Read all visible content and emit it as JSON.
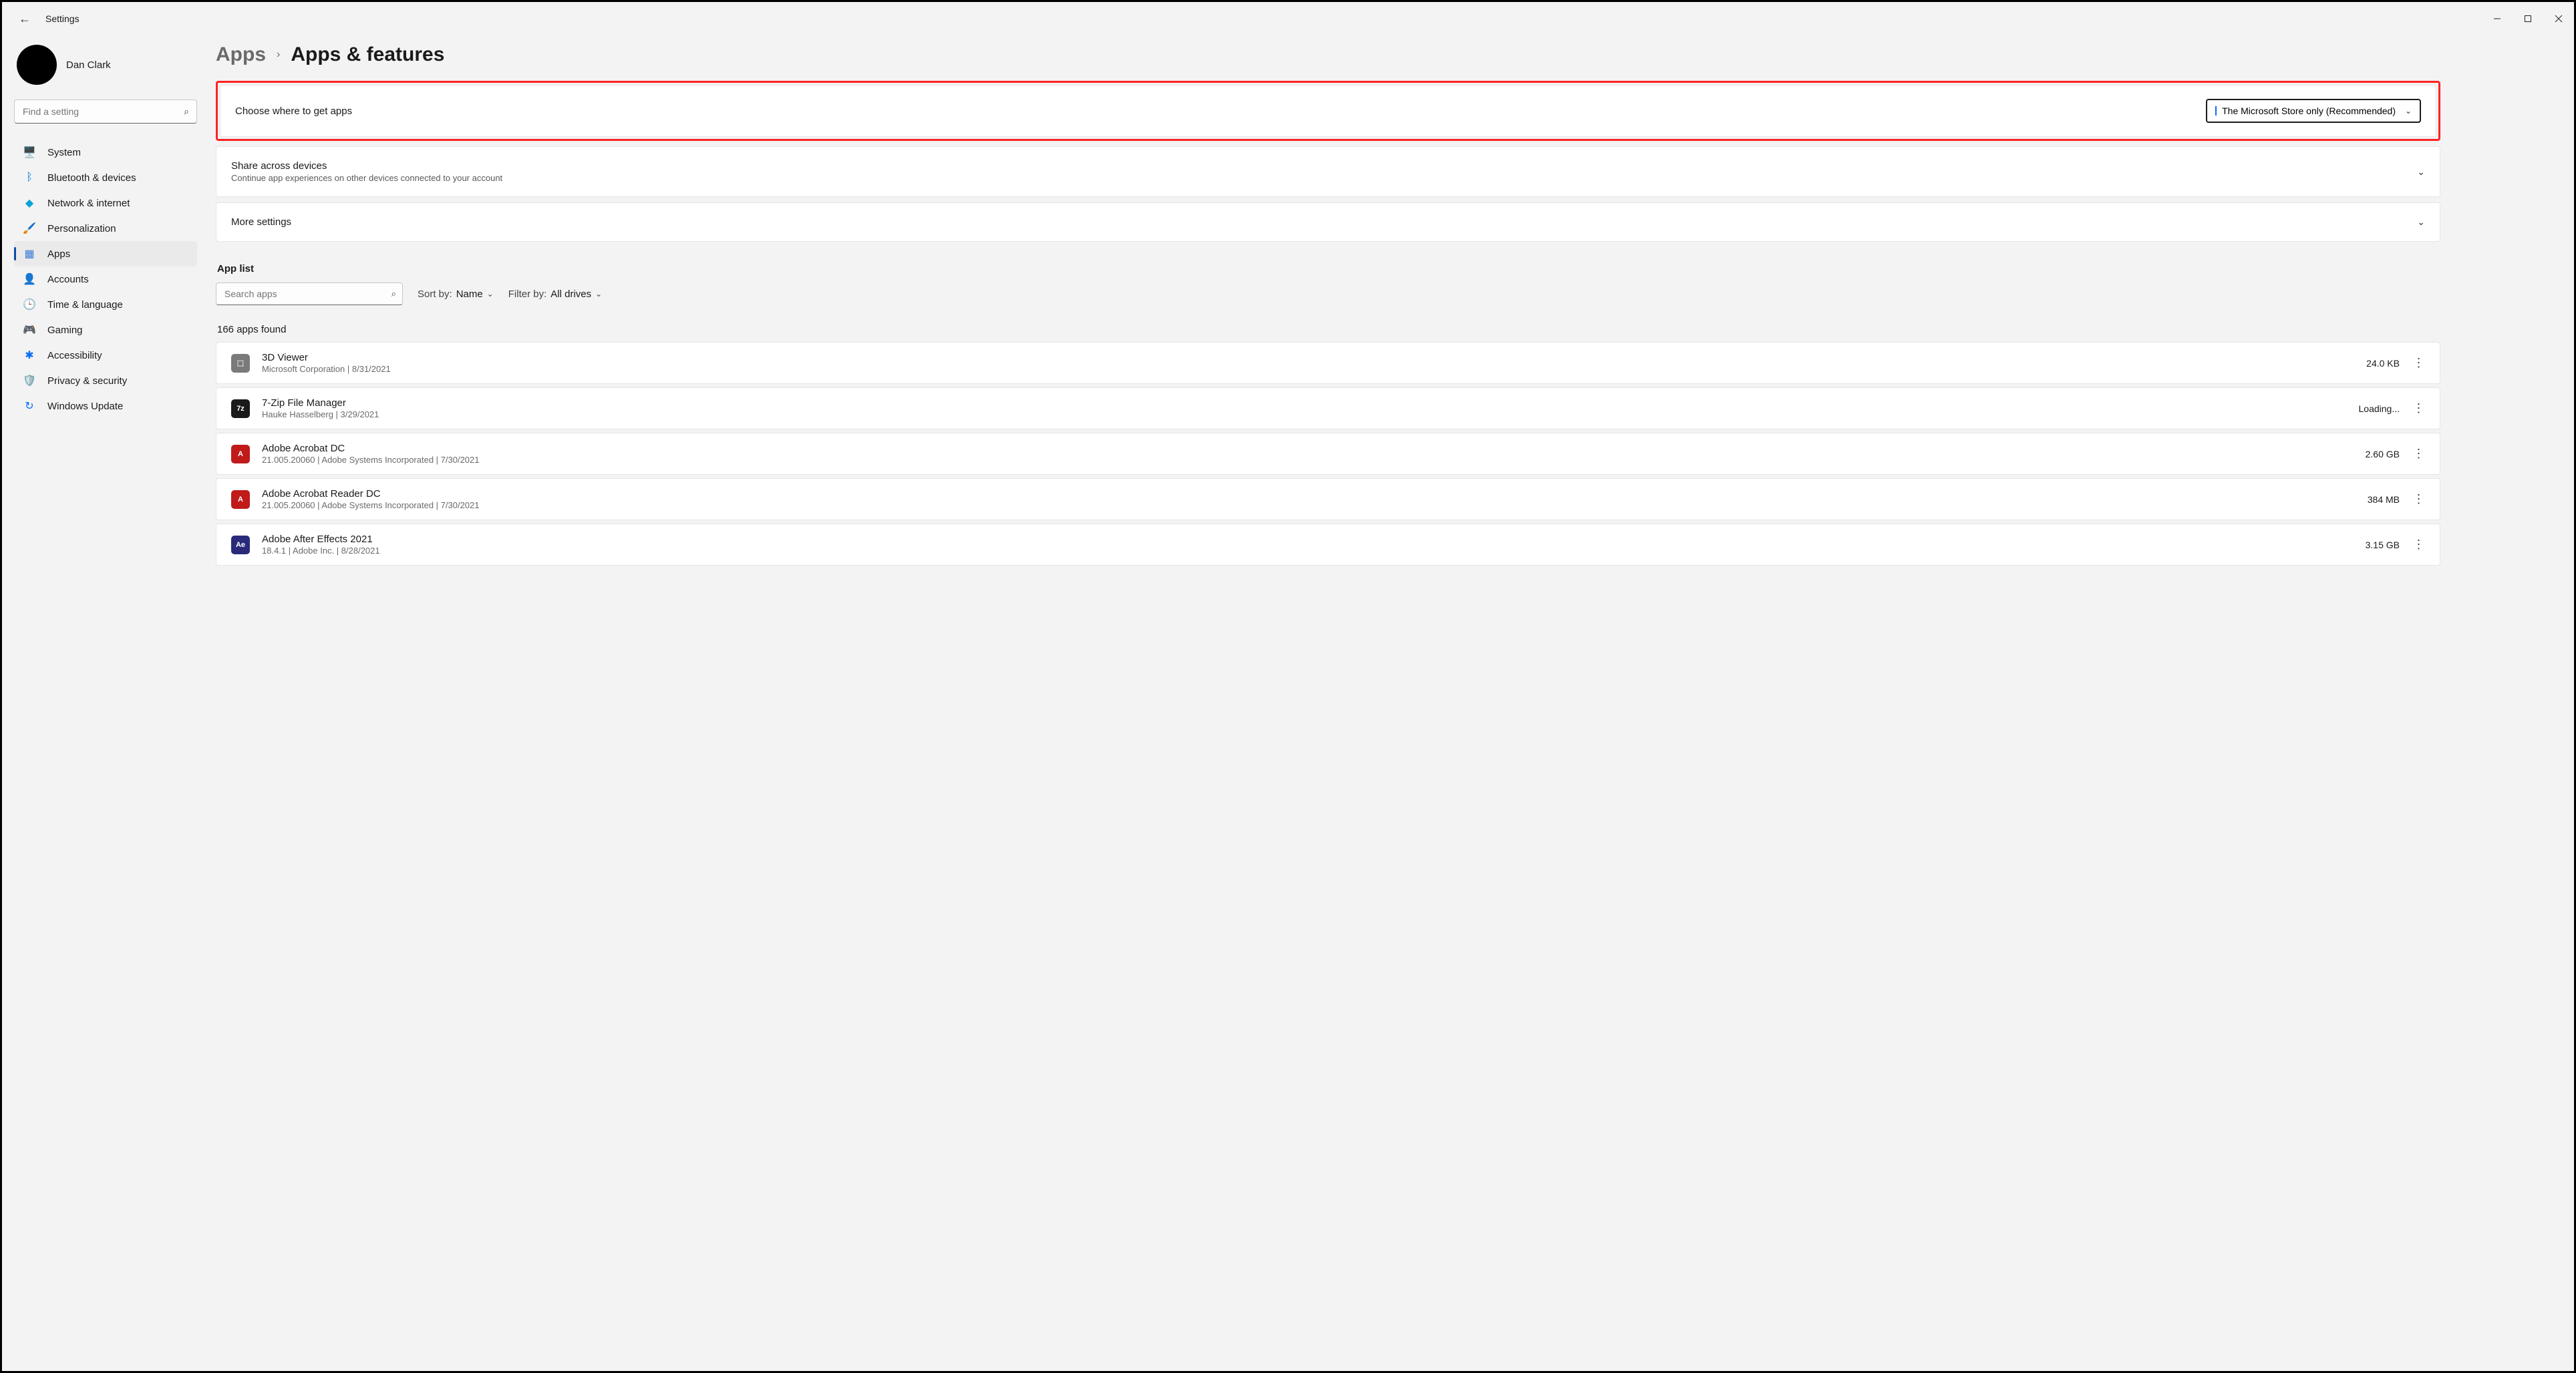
{
  "app_title": "Settings",
  "profile": {
    "name": "Dan Clark"
  },
  "search_placeholder": "Find a setting",
  "nav": [
    {
      "label": "System",
      "icon": "🖥️",
      "hex": "#0078d4"
    },
    {
      "label": "Bluetooth & devices",
      "icon": "ᛒ",
      "hex": "#0078d4"
    },
    {
      "label": "Network & internet",
      "icon": "◆",
      "hex": "#0aa3d8"
    },
    {
      "label": "Personalization",
      "icon": "🖌️",
      "hex": "#d87b3a"
    },
    {
      "label": "Apps",
      "icon": "▦",
      "hex": "#3a7bd8"
    },
    {
      "label": "Accounts",
      "icon": "👤",
      "hex": "#2aa35a"
    },
    {
      "label": "Time & language",
      "icon": "🕒",
      "hex": "#5a5a5a"
    },
    {
      "label": "Gaming",
      "icon": "🎮",
      "hex": "#7a7a7a"
    },
    {
      "label": "Accessibility",
      "icon": "✱",
      "hex": "#0a6cf0"
    },
    {
      "label": "Privacy & security",
      "icon": "🛡️",
      "hex": "#7a7a7a"
    },
    {
      "label": "Windows Update",
      "icon": "↻",
      "hex": "#0a6cf0"
    }
  ],
  "breadcrumb": {
    "parent": "Apps",
    "current": "Apps & features"
  },
  "choose_where": {
    "label": "Choose where to get apps",
    "selected": "The Microsoft Store only (Recommended)"
  },
  "share_across": {
    "title": "Share across devices",
    "subtitle": "Continue app experiences on other devices connected to your account"
  },
  "more_settings": {
    "title": "More settings"
  },
  "app_list_label": "App list",
  "search_apps_placeholder": "Search apps",
  "sort_by": {
    "label": "Sort by:",
    "value": "Name"
  },
  "filter_by": {
    "label": "Filter by:",
    "value": "All drives"
  },
  "apps_found": "166 apps found",
  "apps": [
    {
      "name": "3D Viewer",
      "sub": "Microsoft Corporation  |  8/31/2021",
      "size": "24.0 KB",
      "icon_bg": "#7a7a7a",
      "icon_txt": "⬚"
    },
    {
      "name": "7-Zip File Manager",
      "sub": "Hauke Hasselberg  |  3/29/2021",
      "size": "Loading...",
      "icon_bg": "#1a1a1a",
      "icon_txt": "7z"
    },
    {
      "name": "Adobe Acrobat DC",
      "sub": "21.005.20060  |  Adobe Systems Incorporated  |  7/30/2021",
      "size": "2.60 GB",
      "icon_bg": "#c11a1a",
      "icon_txt": "A"
    },
    {
      "name": "Adobe Acrobat Reader DC",
      "sub": "21.005.20060  |  Adobe Systems Incorporated  |  7/30/2021",
      "size": "384 MB",
      "icon_bg": "#c11a1a",
      "icon_txt": "A"
    },
    {
      "name": "Adobe After Effects 2021",
      "sub": "18.4.1  |  Adobe Inc.  |  8/28/2021",
      "size": "3.15 GB",
      "icon_bg": "#2a2a7a",
      "icon_txt": "Ae"
    }
  ]
}
